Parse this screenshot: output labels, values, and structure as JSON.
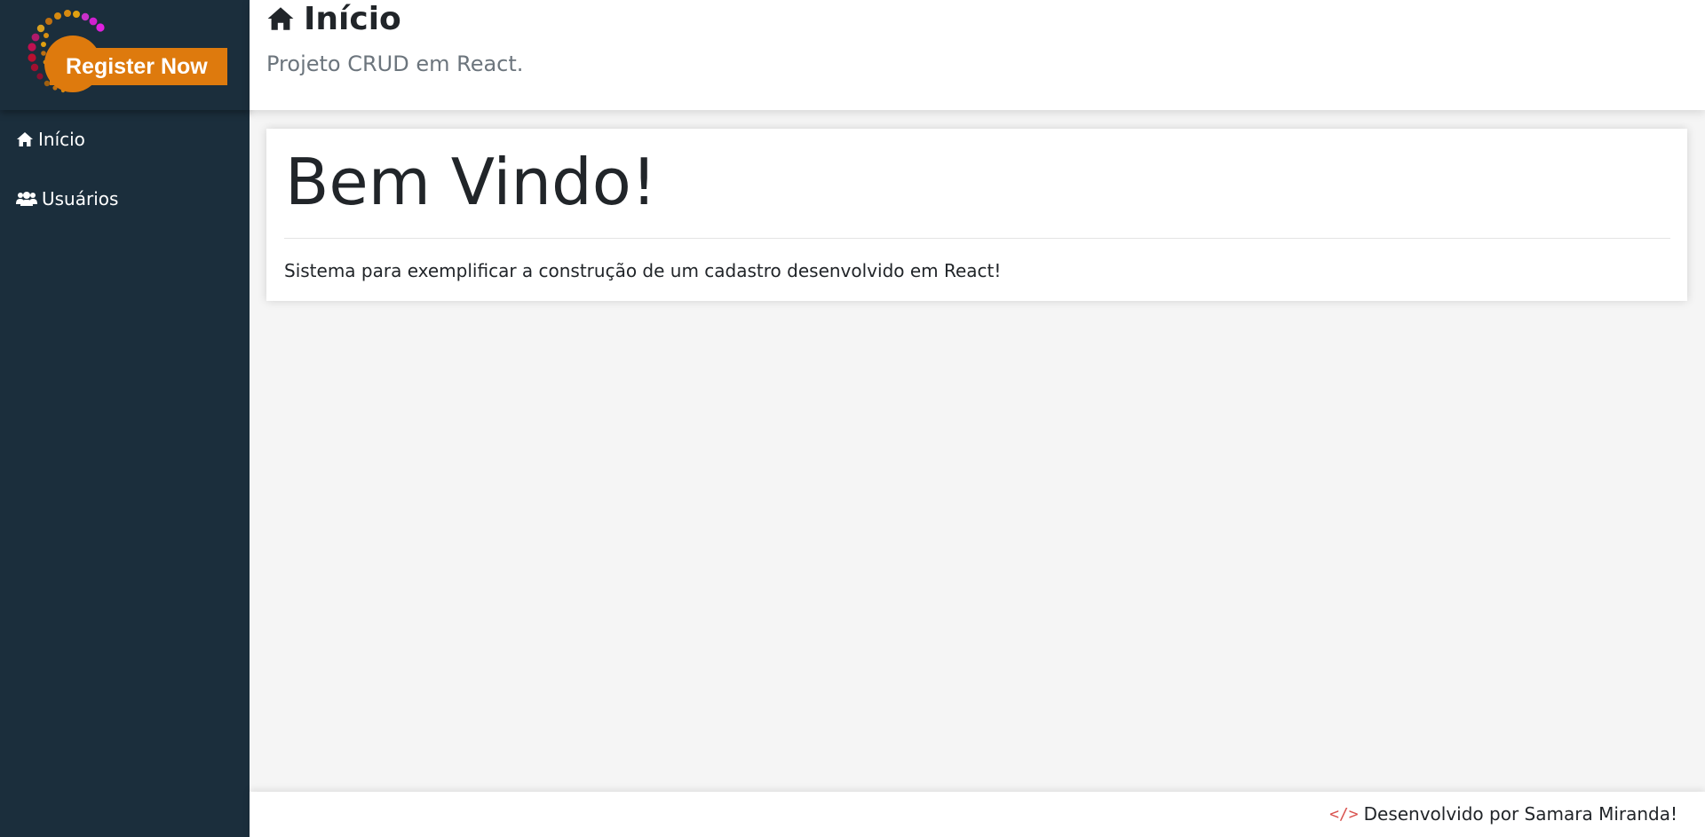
{
  "logo": {
    "badge_text": "Register Now"
  },
  "sidebar": {
    "items": [
      {
        "label": "Início",
        "icon": "home-icon"
      },
      {
        "label": "Usuários",
        "icon": "users-icon"
      }
    ]
  },
  "header": {
    "title": "Início",
    "title_icon": "home-icon",
    "subtitle": "Projeto CRUD em React."
  },
  "main": {
    "heading": "Bem Vindo!",
    "description": "Sistema para exemplificar a construção de um cadastro desenvolvido em React!"
  },
  "footer": {
    "code_symbol": "</>",
    "credit": "Desenvolvido por Samara Miranda!",
    "icon_color": "#d9534f"
  },
  "colors": {
    "sidebar": "#1b2e3c",
    "logo_badge": "#de7a0d",
    "content_bg": "#f5f5f5"
  }
}
